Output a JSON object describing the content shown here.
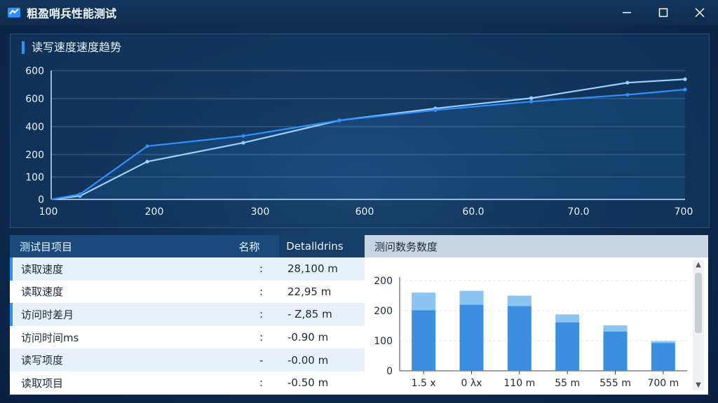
{
  "window": {
    "title": "粗盈哨兵性能测试"
  },
  "chart_panel": {
    "title": "读写速度速度趋势"
  },
  "chart_data": [
    {
      "type": "line",
      "title": "读写速度速度趋势",
      "x_tick_labels": [
        "100",
        "200",
        "300",
        "600",
        "60.0",
        "70.0",
        "700"
      ],
      "y_tick_labels": [
        "0",
        "100",
        "200",
        "400",
        "600",
        "600"
      ],
      "series": [
        {
          "color": "#9fcfff",
          "points": [
            [
              0,
              0
            ],
            [
              0.3,
              20
            ],
            [
              1,
              220
            ],
            [
              2,
              330
            ],
            [
              3,
              460
            ],
            [
              4,
              530
            ],
            [
              5,
              590
            ],
            [
              6,
              680
            ],
            [
              6.6,
              700
            ]
          ]
        },
        {
          "color": "#2e90ff",
          "points": [
            [
              0,
              0
            ],
            [
              0.3,
              30
            ],
            [
              1,
              310
            ],
            [
              2,
              370
            ],
            [
              3,
              460
            ],
            [
              4,
              520
            ],
            [
              5,
              570
            ],
            [
              6,
              610
            ],
            [
              6.6,
              640
            ]
          ]
        }
      ],
      "ylim": [
        0,
        750
      ],
      "xlim": [
        0,
        6.6
      ],
      "grid": true
    },
    {
      "type": "bar",
      "title": "测问数务数度",
      "categories": [
        "1.5 x",
        "0 λx",
        "110 m",
        "55 m",
        "555 m",
        "700 m"
      ],
      "series": [
        {
          "values": [
            200,
            218,
            214,
            160,
            130,
            92
          ],
          "color": "#3b8ee0"
        },
        {
          "values": [
            58,
            46,
            34,
            26,
            20,
            6
          ],
          "color": "#8cc4f2"
        }
      ],
      "y_ticks": [
        "0",
        "100",
        "200",
        "200"
      ],
      "ylim": [
        0,
        300
      ],
      "grid": true
    }
  ],
  "table": {
    "headers": [
      "测试目项目",
      "名称",
      "Detalldrins"
    ],
    "rows": [
      {
        "name": "读取速度",
        "sep": ":",
        "value": "28,100 m"
      },
      {
        "name": "读取速度",
        "sep": ":",
        "value": "22,95 m"
      },
      {
        "name": "访问时差月",
        "sep": ":",
        "value": "- Z,85 m"
      },
      {
        "name": "访问时间ms",
        "sep": ":",
        "value": "-0.90 m"
      },
      {
        "name": "读写项度",
        "sep": "-",
        "value": "-0.00 m"
      },
      {
        "name": "读取项目",
        "sep": ":",
        "value": "-0.50 m"
      }
    ]
  },
  "bar_panel": {
    "title": "测问数务数度"
  },
  "colors": {
    "accent": "#2e90ff",
    "titlebar": "#13375e",
    "header": "#1b4a7c"
  }
}
